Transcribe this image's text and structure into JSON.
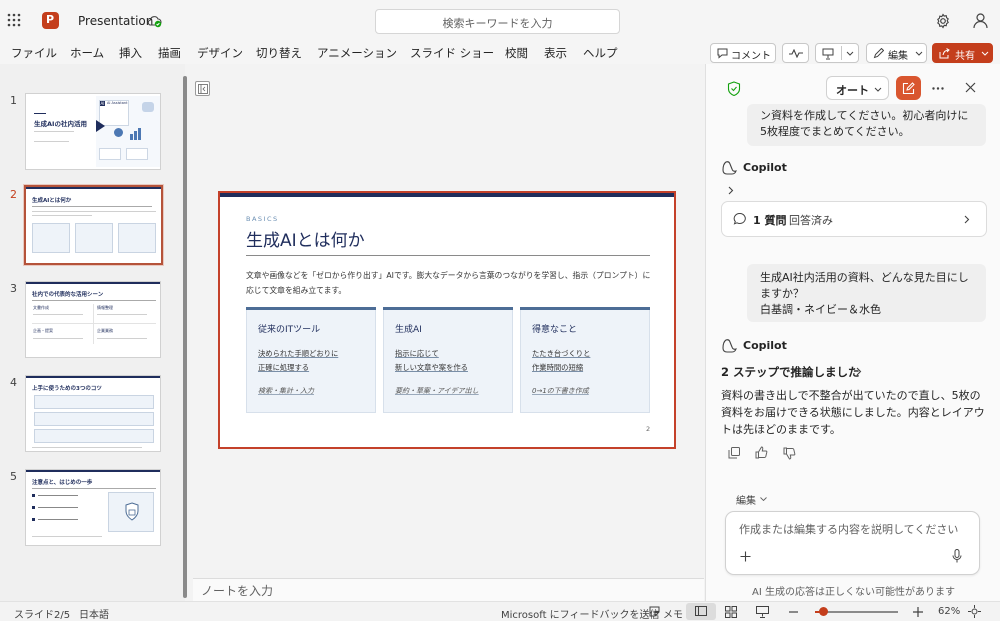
{
  "app": {
    "title": "Presentation",
    "search_placeholder": "検索キーワードを入力",
    "accent": "#c43e1c"
  },
  "ribbon": {
    "tabs": [
      "ファイル",
      "ホーム",
      "挿入",
      "描画",
      "デザイン",
      "切り替え",
      "アニメーション",
      "スライド ショー",
      "校閲",
      "表示",
      "ヘルプ"
    ],
    "comment_label": "コメント",
    "edit_label": "編集",
    "share_label": "共有"
  },
  "thumbnails": {
    "numbers": [
      "1",
      "2",
      "3",
      "4",
      "5"
    ],
    "t1_title": "生成AIの社内活用",
    "t1_panel": "AI Assistant",
    "t2_title": "生成AIとは何か",
    "t3_title": "社内での代表的な活用シーン",
    "t3_items": [
      "文書作成",
      "情報整理",
      "企画・提案",
      "企業業務"
    ],
    "t4_title": "上手に使うための3つのコツ",
    "t5_title": "注意点と、はじめの一歩"
  },
  "slide": {
    "kicker": "BASICS",
    "title": "生成AIとは何か",
    "intro": "文章や画像などを「ゼロから作り出す」AIです。膨大なデータから言葉のつながりを学習し、指示（プロンプト）に応じて文章を組み立てます。",
    "cards": [
      {
        "heading": "従来のITツール",
        "line1": "決められた手順どおりに",
        "line2": "正確に処理する",
        "note": "検索・集計・入力"
      },
      {
        "heading": "生成AI",
        "line1": "指示に応じて",
        "line2": "新しい文章や案を作る",
        "note": "要約・草案・アイデア出し"
      },
      {
        "heading": "得意なこと",
        "line1": "たたき台づくりと",
        "line2": "作業時間の短縮",
        "note": "0→1の下書き作成"
      }
    ],
    "page_number": "2"
  },
  "notes_placeholder": "ノートを入力",
  "copilot": {
    "mode_label": "オート",
    "prev_user_msg_line1": "ン資料を作成してください。初心者向けに",
    "prev_user_msg_line2": "5枚程度でまとめてください。",
    "copilot_name": "Copilot",
    "question_count": "1 質問",
    "question_status": "回答済み",
    "user_msg_line1": "生成AI社内活用の資料、どんな見た目にし",
    "user_msg_line2": "ますか？",
    "user_msg_line3": "白基調・ネイビー＆水色",
    "reasoning_label": "2 ステップで推論しました",
    "ai_reply_line1": "資料の書き出しで不整合が出ていたので直し、5枚の",
    "ai_reply_line2": "資料をお届けできる状態にしました。内容とレイアウ",
    "ai_reply_line3": "トは先ほどのままです。",
    "edit_mode_label": "編集",
    "input_placeholder": "作成または編集する内容を説明してください",
    "disclaimer": "AI 生成の応答は正しくない可能性があります"
  },
  "status": {
    "slide_indicator": "スライド2/5",
    "language": "日本語",
    "feedback": "Microsoft にフィードバックを送信",
    "notes_label": "メモ",
    "zoom_level": "62%",
    "zoom_fraction": 0.1
  }
}
